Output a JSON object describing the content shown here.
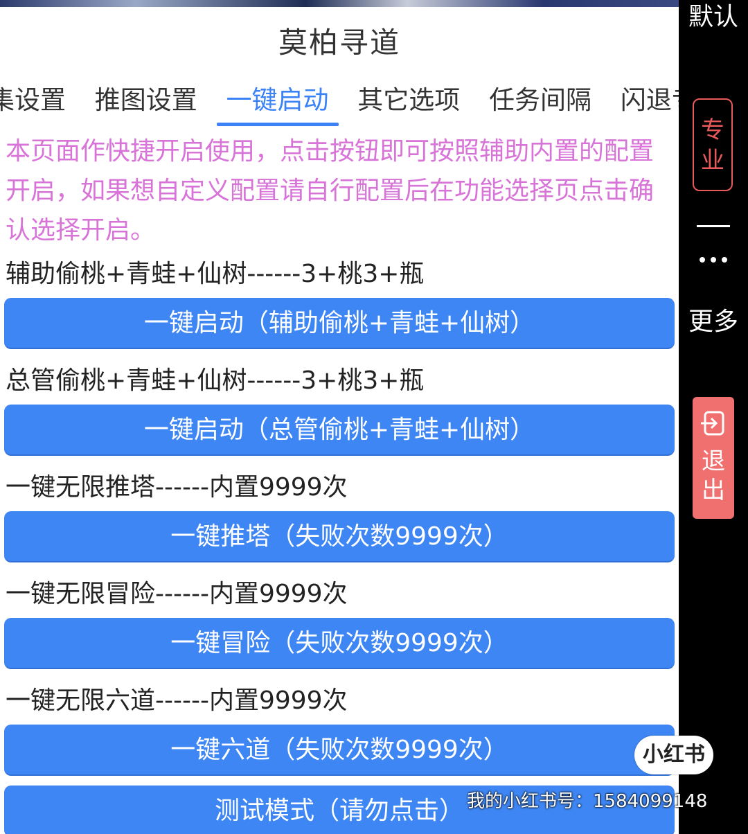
{
  "app": {
    "title": "莫柏寻道"
  },
  "tabs": [
    {
      "label": "集设置"
    },
    {
      "label": "推图设置"
    },
    {
      "label": "一键启动"
    },
    {
      "label": "其它选项"
    },
    {
      "label": "任务间隔"
    },
    {
      "label": "闪退专题"
    }
  ],
  "active_tab": "一键启动",
  "notice": "本页面作快捷开启使用，点击按钮即可按照辅助内置的配置开启，如果想自定义配置请自行配置后在功能选择页点击确认选择开启。",
  "rows": [
    {
      "label": "辅助偷桃+青蛙+仙树------3+桃3+瓶",
      "button": "一键启动（辅助偷桃+青蛙+仙树）"
    },
    {
      "label": "总管偷桃+青蛙+仙树------3+桃3+瓶",
      "button": "一键启动（总管偷桃+青蛙+仙树）"
    },
    {
      "label": "一键无限推塔------内置9999次",
      "button": "一键推塔（失败次数9999次）"
    },
    {
      "label": "一键无限冒险------内置9999次",
      "button": "一键冒险（失败次数9999次）"
    },
    {
      "label": "一键无限六道------内置9999次",
      "button": "一键六道（失败次数9999次）"
    }
  ],
  "test_button": "测试模式（请勿点击）",
  "sidebar": {
    "default_label": "默认",
    "pro_label": "专业",
    "more_label": "更多",
    "exit_label": "退出",
    "icons": [
      "minimize-icon",
      "more-dots-icon",
      "exit-icon"
    ]
  },
  "watermark": {
    "logo": "小红书",
    "text": "我的小红书号：1584099148"
  },
  "colors": {
    "accent": "#3e86f3",
    "notice": "#d873d8",
    "exit": "#f07070"
  }
}
